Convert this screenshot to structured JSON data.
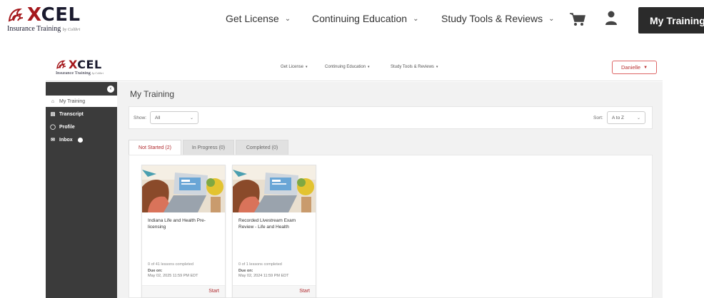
{
  "site": {
    "logo": {
      "word_prefix": "X",
      "word_rest": "CEL",
      "tagline": "Insurance Training",
      "tagline_small": "by Colibri"
    },
    "nav": [
      {
        "label": "Get License"
      },
      {
        "label": "Continuing Education"
      },
      {
        "label": "Study Tools & Reviews"
      }
    ],
    "cta_label": "My Training"
  },
  "app": {
    "logo": {
      "word_prefix": "X",
      "word_rest": "CEL",
      "tagline": "Insurance Training",
      "tagline_small": "by Colibri"
    },
    "nav": [
      {
        "label": "Get License"
      },
      {
        "label": "Continuing Education"
      },
      {
        "label": "Study Tools & Reviews"
      }
    ],
    "user_menu": {
      "label": "Danielle"
    },
    "sidebar": {
      "items": [
        {
          "label": "My Training",
          "icon": "home-icon"
        },
        {
          "label": "Transcript",
          "icon": "document-icon"
        },
        {
          "label": "Profile",
          "icon": "person-icon"
        },
        {
          "label": "Inbox",
          "icon": "mail-icon"
        }
      ]
    },
    "page_title": "My Training",
    "filters": {
      "show_label": "Show:",
      "show_value": "All",
      "sort_label": "Sort:",
      "sort_value": "A to Z"
    },
    "tabs": [
      {
        "label": "Not Started (2)",
        "active": true
      },
      {
        "label": "In Progress (0)",
        "active": false
      },
      {
        "label": "Completed (0)",
        "active": false
      }
    ],
    "courses": [
      {
        "title": "Indiana Life and Health Pre-licensing",
        "progress": "0 of 41 lessons completed",
        "due_label": "Due on:",
        "due": "May 02, 2025 11:59 PM EDT",
        "action": "Start"
      },
      {
        "title": "Recorded Livestream Exam Review - Life and Health",
        "progress": "0 of 1 lessons completed",
        "due_label": "Due on:",
        "due": "May 02, 2024 11:59 PM EDT",
        "action": "Start"
      }
    ]
  },
  "colors": {
    "brand_red": "#a5181c",
    "dark": "#2b2b2b",
    "sidebar": "#3b3b3b",
    "accent_text": "#b02a2e"
  }
}
